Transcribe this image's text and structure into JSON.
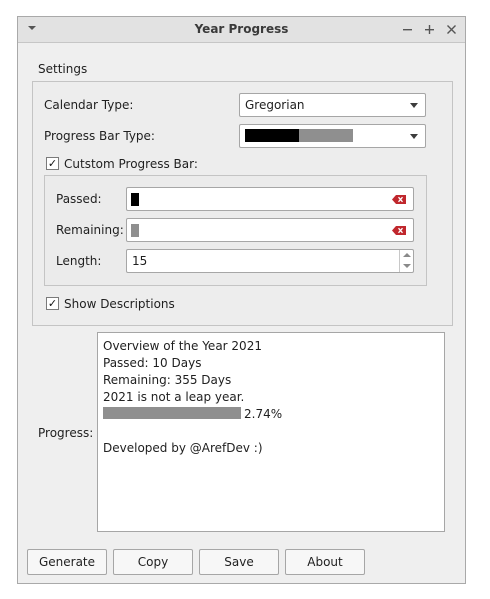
{
  "window": {
    "title": "Year Progress"
  },
  "settings": {
    "group_title": "Settings",
    "calendar_type_label": "Calendar Type:",
    "calendar_type_value": "Gregorian",
    "progress_bar_type_label": "Progress Bar Type:",
    "progress_bar_type_preview": {
      "passed_blocks": 6,
      "remaining_blocks": 6
    },
    "custom_progress_bar_label": "Cutstom Progress Bar:",
    "custom_progress_bar_checked": true,
    "passed_label": "Passed:",
    "remaining_label": "Remaining:",
    "length_label": "Length:",
    "length_value": "15",
    "show_descriptions_label": "Show Descriptions",
    "show_descriptions_checked": true
  },
  "progress": {
    "label": "Progress:",
    "lines": [
      "Overview of the Year 2021",
      "Passed: 10 Days",
      "Remaining: 355 Days",
      "2021 is not a leap year."
    ],
    "percent_text": "2.74%",
    "percent_value": 0.0274,
    "footer": "Developed by @ArefDev :)"
  },
  "buttons": {
    "generate": "Generate",
    "copy": "Copy",
    "save": "Save",
    "about": "About"
  },
  "icons": {
    "window_menu": "chevron-down-icon",
    "minimize": "minus-icon",
    "maximize": "plus-icon",
    "close": "close-icon",
    "clear": "clear-input-icon"
  },
  "colors": {
    "clear_icon": "#c0272d",
    "window_bg": "#efefef"
  }
}
